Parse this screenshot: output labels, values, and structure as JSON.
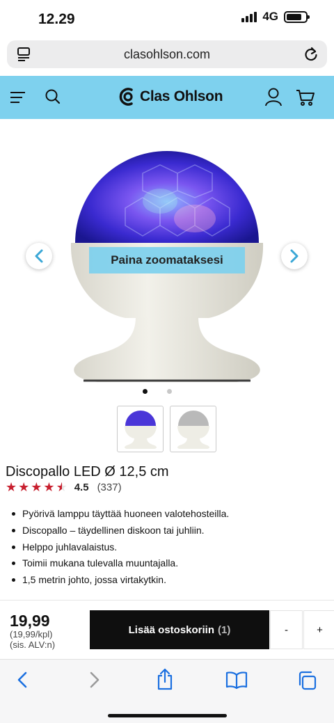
{
  "status_bar": {
    "time": "12.29",
    "network": "4G"
  },
  "browser": {
    "url": "clasohlson.com"
  },
  "header": {
    "brand": "Clas Ohlson"
  },
  "gallery": {
    "zoom_hint": "Paina zoomataksesi",
    "active_slide": 1,
    "total_slides": 2
  },
  "product": {
    "title": "Discopallo LED Ø 12,5 cm",
    "rating": {
      "value": 4.5,
      "max": 5,
      "score_text": "4.5",
      "count_text": "(337)"
    },
    "features": [
      "Pyörivä lamppu täyttää huoneen valotehosteilla.",
      "Discopallo – täydellinen diskoon tai juhliin.",
      "Helppo juhlavalaistus.",
      "Toimii mukana tulevalla muuntajalla.",
      "1,5 metrin johto, jossa virtakytkin."
    ]
  },
  "purchase": {
    "price": "19,99",
    "unit_price": "(19,99/kpl)",
    "vat_note": "(sis. ALV:n)",
    "add_to_cart": "Lisää ostoskoriin",
    "quantity": "(1)",
    "minus": "-",
    "plus": "+"
  },
  "colors": {
    "header_bg": "#7ed1ee",
    "star": "#c8202f",
    "button_bg": "#0f0f0f",
    "ios_blue": "#1a6fe0"
  }
}
